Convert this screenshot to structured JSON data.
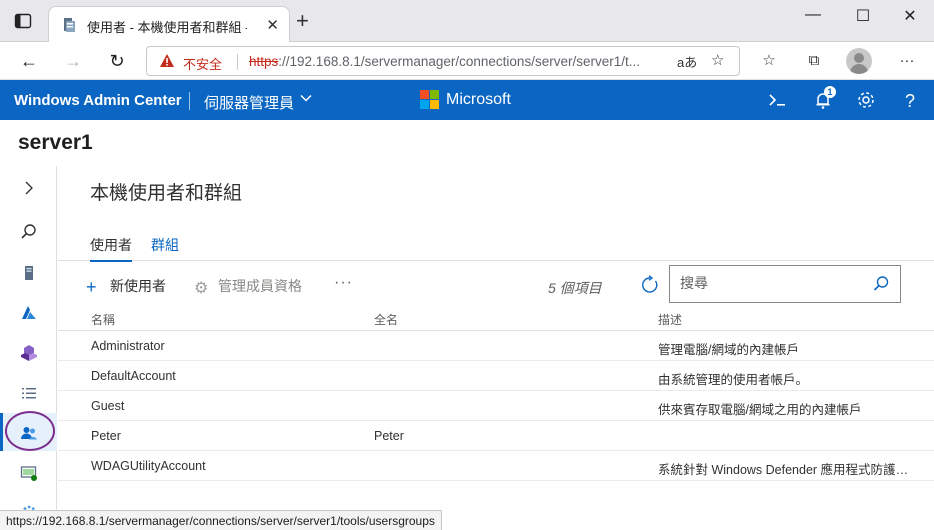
{
  "browser": {
    "tab_title": "使用者 - 本機使用者和群組 - 伺服",
    "insecure_label": "不安全",
    "url_protocol": "https",
    "url_rest": "://192.168.8.1/servermanager/connections/server/server1/t...",
    "read_aloud": "aあ",
    "status_url": "https://192.168.8.1/servermanager/connections/server/server1/tools/usersgroups"
  },
  "header": {
    "brand": "Windows Admin Center",
    "context": "伺服器管理員",
    "microsoft": "Microsoft",
    "notification_count": "1",
    "colors": {
      "bar": "#0a66c2",
      "ms_red": "#f25022",
      "ms_green": "#7fba00",
      "ms_blue": "#00a4ef",
      "ms_yellow": "#ffb900"
    }
  },
  "server_name": "server1",
  "tool": {
    "title": "本機使用者和群組",
    "tabs": [
      {
        "label": "使用者",
        "active": true
      },
      {
        "label": "群組",
        "active": false
      }
    ],
    "commands": {
      "new_user": "新使用者",
      "manage_membership": "管理成員資格",
      "more": "···"
    },
    "item_count": "5 個項目",
    "search_placeholder": "搜尋"
  },
  "grid": {
    "columns": [
      "名稱",
      "全名",
      "描述"
    ],
    "rows": [
      {
        "name": "Administrator",
        "full_name": "",
        "description": "管理電腦/網域的內建帳戶"
      },
      {
        "name": "DefaultAccount",
        "full_name": "",
        "description": "由系統管理的使用者帳戶。"
      },
      {
        "name": "Guest",
        "full_name": "",
        "description": "供來賓存取電腦/網域之用的內建帳戶"
      },
      {
        "name": "Peter",
        "full_name": "Peter",
        "description": ""
      },
      {
        "name": "WDAGUtilityAccount",
        "full_name": "",
        "description": "系統針對 Windows Defender 應用程式防護案..."
      }
    ]
  },
  "rail_icons": [
    "chevron-right-icon",
    "search-icon",
    "server-overview-icon",
    "azure-icon",
    "azure-hybrid-icon",
    "list-icon",
    "users-icon",
    "firewall-icon",
    "settings-icon"
  ]
}
